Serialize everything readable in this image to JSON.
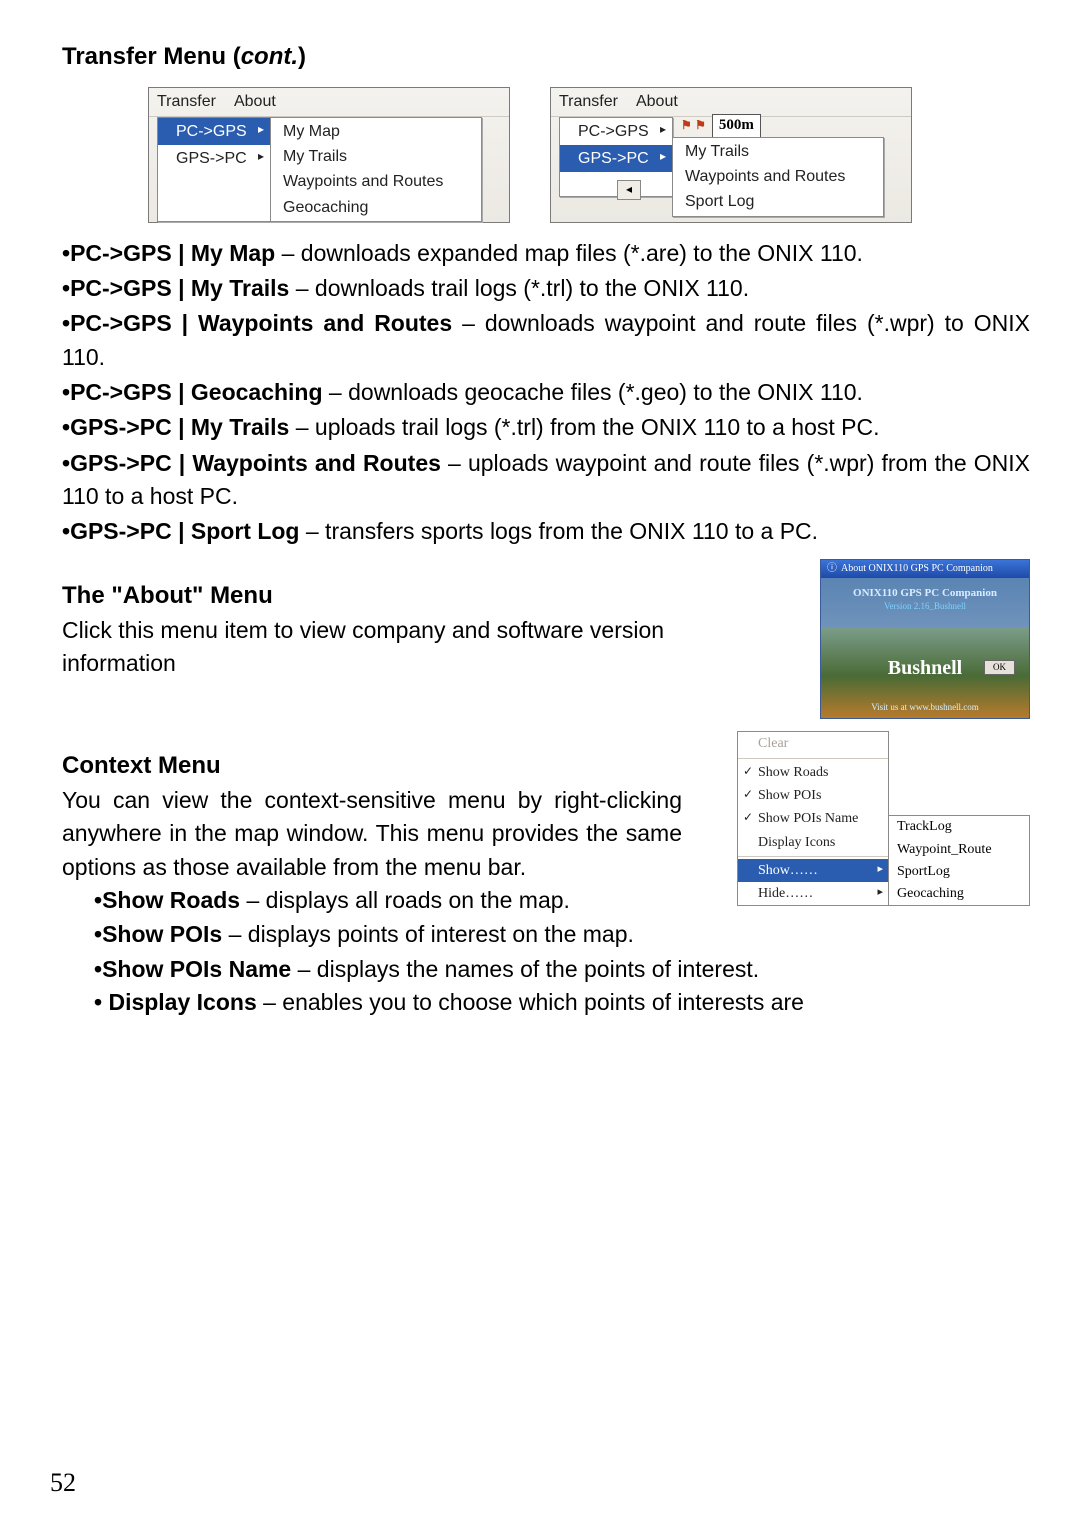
{
  "title_prefix": "Transfer Menu (",
  "title_ital": "cont.",
  "title_suffix": ")",
  "menu1": {
    "bar": [
      "Transfer",
      "About"
    ],
    "col1": [
      {
        "label": "PC->GPS",
        "hl": true
      },
      {
        "label": "GPS->PC",
        "hl": false
      }
    ],
    "col2": [
      "My Map",
      "My Trails",
      "Waypoints and Routes",
      "Geocaching"
    ]
  },
  "menu2": {
    "bar": [
      "Transfer",
      "About"
    ],
    "col1": [
      {
        "label": "PC->GPS",
        "hl": false
      },
      {
        "label": "GPS->PC",
        "hl": true
      }
    ],
    "scale": "500m",
    "back": "◂",
    "col2": [
      "My Trails",
      "Waypoints and Routes",
      "Sport Log"
    ]
  },
  "desc": [
    {
      "lead": "PC->GPS | My Map",
      "rest": " – downloads expanded map files (*.are) to the ONIX 110."
    },
    {
      "lead": "PC->GPS | My Trails",
      "rest": " – downloads trail logs (*.trl) to the ONIX 110."
    },
    {
      "lead": "PC->GPS | Waypoints and Routes",
      "rest": " – downloads waypoint and route files (*.wpr) to ONIX 110."
    },
    {
      "lead": "PC->GPS | Geocaching",
      "rest": " – downloads geocache files (*.geo) to the ONIX 110."
    },
    {
      "lead": "GPS->PC | My Trails",
      "rest": "  – uploads trail logs (*.trl) from the ONIX 110 to a host PC."
    },
    {
      "lead": "GPS->PC |  Waypoints and  Routes",
      "rest": " –  uploads  waypoint  and route files (*.wpr) from the ONIX 110 to a host PC."
    },
    {
      "lead": "GPS->PC | Sport Log",
      "rest": " – transfers sports logs from the ONIX 110 to a PC."
    }
  ],
  "about_h": "The \"About\" Menu",
  "about_p": "Click this menu item to view company and software version information",
  "about_dlg": {
    "title": "About ONIX110 GPS PC Companion",
    "line1": "ONIX110 GPS PC Companion",
    "line2": "Version 2.16_Bushnell",
    "logo": "Bushnell",
    "ok": "OK",
    "url": "Visit us at www.bushnell.com"
  },
  "ctx_h": "Context Menu",
  "ctx_p": "You can view the context-sensitive menu by right-clicking anywhere in the map window. This menu provides the same options as those available from the menu bar.",
  "ctx_menu1": [
    {
      "label": "Clear",
      "dim": true
    },
    {
      "sep": true
    },
    {
      "label": "Show Roads",
      "chk": true
    },
    {
      "label": "Show POIs",
      "chk": true
    },
    {
      "label": "Show POIs Name",
      "chk": true
    },
    {
      "label": "Display Icons"
    },
    {
      "sep": true
    },
    {
      "label": "Show……",
      "hl": true,
      "arrow": true
    },
    {
      "label": "Hide……",
      "arrow": true
    }
  ],
  "ctx_menu2": [
    "TrackLog",
    "Waypoint_Route",
    "SportLog",
    "Geocaching"
  ],
  "ctx_bullets": [
    {
      "lead": "Show Roads",
      "rest": " – displays all roads on the map."
    },
    {
      "lead": "Show POIs",
      "rest": " – displays points of interest on the map."
    }
  ],
  "ctx_bullet_full": {
    "lead": "Show POIs Name",
    "rest": " – displays the names of the points of interest."
  },
  "ctx_bullet_last": {
    "lead": "Display Icons",
    "rest": " – enables you to choose which points of interests are"
  },
  "page_num": "52"
}
